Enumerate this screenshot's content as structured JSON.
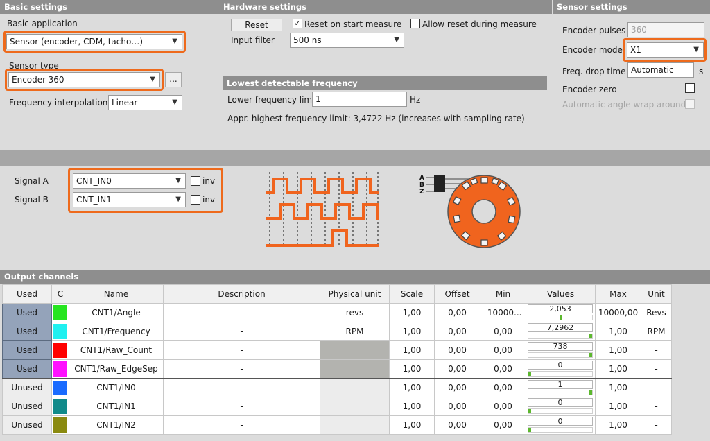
{
  "basic": {
    "header": "Basic settings",
    "app_label": "Basic application",
    "app_value": "Sensor (encoder, CDM, tacho…)",
    "sensor_type_label": "Sensor type",
    "sensor_type_value": "Encoder-360",
    "more_label": "...",
    "interp_label": "Frequency interpolation",
    "interp_value": "Linear"
  },
  "hardware": {
    "header": "Hardware settings",
    "reset_label": "Reset",
    "reset_on_start_label": "Reset on start measure",
    "reset_on_start_checked": true,
    "allow_reset_label": "Allow reset during measure",
    "allow_reset_checked": false,
    "input_filter_label": "Input filter",
    "input_filter_value": "500 ns"
  },
  "lowest": {
    "header": "Lowest detectable frequency",
    "lower_limit_label": "Lower frequency limit",
    "lower_limit_value": "1",
    "lower_limit_unit": "Hz",
    "highest_text": "Appr. highest frequency limit: 3,4722 Hz (increases with sampling rate)"
  },
  "sensor": {
    "header": "Sensor settings",
    "pulses_label": "Encoder pulses",
    "pulses_value": "360",
    "mode_label": "Encoder mode",
    "mode_value": "X1",
    "drop_label": "Freq. drop time",
    "drop_value": "Automatic",
    "drop_unit": "s",
    "zero_label": "Encoder zero",
    "wrap_label": "Automatic angle wrap around"
  },
  "signals": {
    "a_label": "Signal A",
    "a_value": "CNT_IN0",
    "b_label": "Signal B",
    "b_value": "CNT_IN1",
    "inv_label": "inv",
    "diagram_letters": [
      "A",
      "B",
      "Z"
    ]
  },
  "output": {
    "header": "Output channels",
    "columns": [
      "Used",
      "C",
      "Name",
      "Description",
      "Physical unit",
      "Scale",
      "Offset",
      "Min",
      "Values",
      "Max",
      "Unit"
    ],
    "rows": [
      {
        "used": "Used",
        "color": "#26e51f",
        "name": "CNT1/Angle",
        "desc": "-",
        "phys": "revs",
        "scale": "1,00",
        "offset": "0,00",
        "min": "-10000...",
        "value": "2,053",
        "level": 0.51,
        "max": "10000,00",
        "unit": "Revs"
      },
      {
        "used": "Used",
        "color": "#20f0f0",
        "name": "CNT1/Frequency",
        "desc": "-",
        "phys": "RPM",
        "scale": "1,00",
        "offset": "0,00",
        "min": "0,00",
        "value": "7,2962",
        "level": 1.0,
        "max": "1,00",
        "unit": "RPM"
      },
      {
        "used": "Used",
        "color": "#ff0000",
        "name": "CNT1/Raw_Count",
        "desc": "-",
        "phys": "",
        "scale": "1,00",
        "offset": "0,00",
        "min": "0,00",
        "value": "738",
        "level": 1.0,
        "max": "1,00",
        "unit": "-"
      },
      {
        "used": "Used",
        "color": "#ff10ff",
        "name": "CNT1/Raw_EdgeSep",
        "desc": "-",
        "phys": "",
        "scale": "1,00",
        "offset": "0,00",
        "min": "0,00",
        "value": "0",
        "level": 0.0,
        "max": "1,00",
        "unit": "-"
      },
      {
        "used": "Unused",
        "color": "#1a6bff",
        "name": "CNT1/IN0",
        "desc": "-",
        "phys": "",
        "scale": "1,00",
        "offset": "0,00",
        "min": "0,00",
        "value": "1",
        "level": 1.0,
        "max": "1,00",
        "unit": "-"
      },
      {
        "used": "Unused",
        "color": "#118a8a",
        "name": "CNT1/IN1",
        "desc": "-",
        "phys": "",
        "scale": "1,00",
        "offset": "0,00",
        "min": "0,00",
        "value": "0",
        "level": 0.0,
        "max": "1,00",
        "unit": "-"
      },
      {
        "used": "Unused",
        "color": "#8a8a10",
        "name": "CNT1/IN2",
        "desc": "-",
        "phys": "",
        "scale": "1,00",
        "offset": "0,00",
        "min": "0,00",
        "value": "0",
        "level": 0.0,
        "max": "1,00",
        "unit": "-"
      }
    ]
  },
  "colors": {
    "accent": "#ee6a1c",
    "header_bg": "#8e8e8e",
    "used_bg": "#94a3ba",
    "panel_bg": "#dcdcdc"
  }
}
